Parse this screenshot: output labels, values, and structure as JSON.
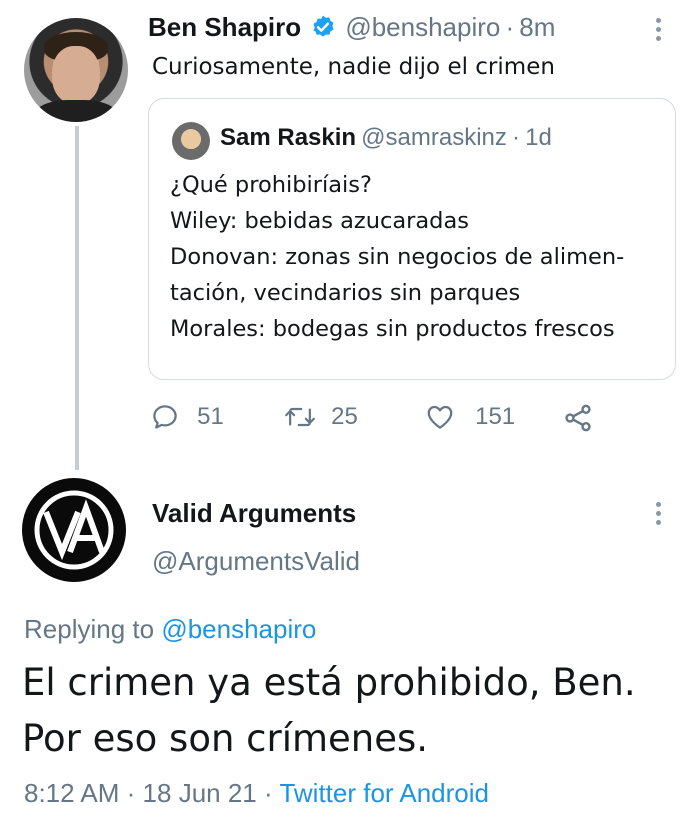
{
  "original_tweet": {
    "author_name": "Ben Shapiro",
    "handle": "@benshapiro",
    "separator": "·",
    "time": "8m",
    "text": "Curiosamente, nadie dijo el crimen",
    "verified_icon": "verified-badge-icon"
  },
  "quoted_tweet": {
    "author_name": "Sam Raskin",
    "handle": "@samraskinz",
    "separator": "·",
    "time": "1d",
    "lines": [
      "¿Qué prohibiríais?",
      "Wiley: bebidas azucaradas",
      "Donovan: zonas sin negocios de alimen-",
      "tación, vecindarios sin parques",
      "Morales: bodegas sin productos frescos"
    ]
  },
  "actions": {
    "replies": "51",
    "retweets": "25",
    "likes": "151"
  },
  "reply_tweet": {
    "author_name": "Valid Arguments",
    "handle": "@ArgumentsValid",
    "replying_prefix": "Replying to",
    "replying_to": "@benshapiro",
    "text_lines": [
      "El crimen ya está prohibido, Ben.",
      "Por eso son crímenes."
    ],
    "time": "8:12 AM",
    "separator": "·",
    "date": "18 Jun 21",
    "source": "Twitter for Android"
  },
  "colors": {
    "link": "#1b95e0",
    "muted": "#657786",
    "verified": "#1da1f2",
    "thread_line": "#c4cdd5"
  }
}
